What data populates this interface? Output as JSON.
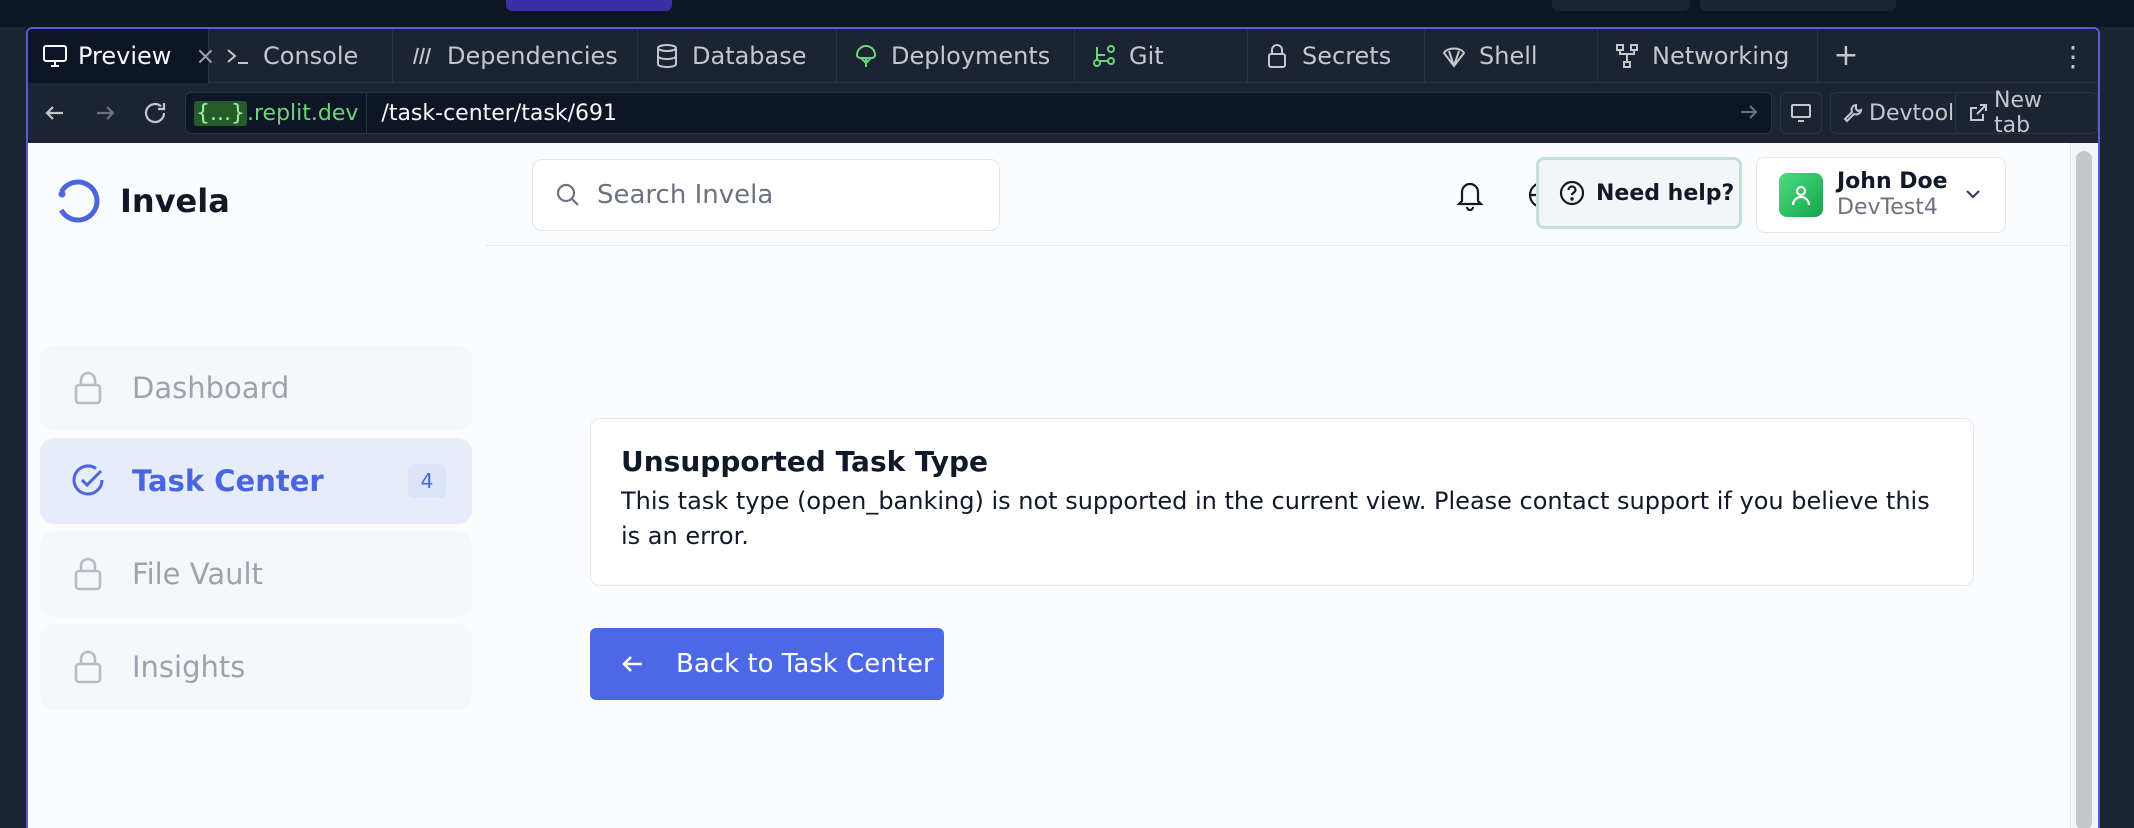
{
  "browser": {
    "tabs": [
      {
        "label": "Preview",
        "icon": "monitor-icon",
        "active": true
      },
      {
        "label": "Console",
        "icon": "terminal-icon"
      },
      {
        "label": "Dependencies",
        "icon": "dependencies-icon"
      },
      {
        "label": "Database",
        "icon": "database-icon"
      },
      {
        "label": "Deployments",
        "icon": "deploy-icon"
      },
      {
        "label": "Git",
        "icon": "git-icon"
      },
      {
        "label": "Secrets",
        "icon": "lock-icon"
      },
      {
        "label": "Shell",
        "icon": "shell-icon"
      },
      {
        "label": "Networking",
        "icon": "network-icon"
      }
    ],
    "close_glyph": "×",
    "add_tab_glyph": "+",
    "more_glyph": "⋮",
    "url": {
      "domain_template": "{...}",
      "domain_suffix": ".replit.dev",
      "path": "/task-center/task/691"
    },
    "devtools_label": "Devtools",
    "new_tab_label": "New tab"
  },
  "app": {
    "brand": "Invela",
    "search_placeholder": "Search Invela",
    "help_label": "Need help?",
    "user": {
      "name": "John Doe",
      "company": "DevTest4"
    },
    "sidebar": [
      {
        "label": "Dashboard",
        "icon": "lock-icon",
        "locked": true
      },
      {
        "label": "Task Center",
        "icon": "check-circle-icon",
        "active": true,
        "badge": "4"
      },
      {
        "label": "File Vault",
        "icon": "lock-icon",
        "locked": true
      },
      {
        "label": "Insights",
        "icon": "lock-icon",
        "locked": true
      }
    ],
    "error": {
      "title": "Unsupported Task Type",
      "message": "This task type (open_banking) is not supported in the current view. Please contact support if you believe this is an error."
    },
    "back_button": "Back to Task Center"
  },
  "colors": {
    "accent": "#4d68e6",
    "frame_border": "#5b5bd6",
    "ide_bg": "#1c2333",
    "domain_green": "#6ed47b"
  }
}
